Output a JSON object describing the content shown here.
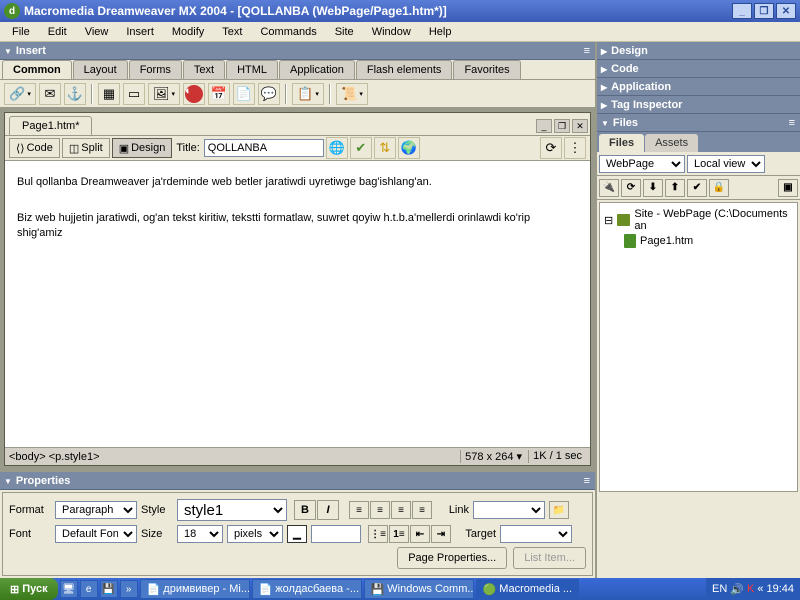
{
  "titlebar": {
    "title": "Macromedia Dreamweaver MX 2004 - [QOLLANBA (WebPage/Page1.htm*)]"
  },
  "menu": [
    "File",
    "Edit",
    "View",
    "Insert",
    "Modify",
    "Text",
    "Commands",
    "Site",
    "Window",
    "Help"
  ],
  "insert_panel": {
    "header": "Insert",
    "tabs": [
      "Common",
      "Layout",
      "Forms",
      "Text",
      "HTML",
      "Application",
      "Flash elements",
      "Favorites"
    ],
    "active_tab": "Common"
  },
  "document": {
    "tab": "Page1.htm*",
    "views": {
      "code": "Code",
      "split": "Split",
      "design": "Design"
    },
    "title_label": "Title:",
    "title_value": "QOLLANBA",
    "body_p1": "Bul qollanba Dreamweaver ja'rdeminde web betler jaratiwdi uyretiwge bag'ishlang'an.",
    "body_p2": "Biz web hujjetin jaratiwdi, og'an tekst kiritiw, tekstti formatlaw, suwret qoyiw h.t.b.a'mellerdi orinlawdi ko'rip shig'amiz",
    "status_left": "<body> <p.style1>",
    "status_dims": "578 x 264",
    "status_size": "1K / 1 sec"
  },
  "properties": {
    "header": "Properties",
    "format_label": "Format",
    "format_value": "Paragraph",
    "style_label": "Style",
    "style_value": "style1",
    "font_label": "Font",
    "font_value": "Default Font",
    "size_label": "Size",
    "size_value": "18",
    "units_value": "pixels",
    "link_label": "Link",
    "target_label": "Target",
    "page_props": "Page Properties...",
    "list_item": "List Item..."
  },
  "right_panels": {
    "design": "Design",
    "code": "Code",
    "application": "Application",
    "tag": "Tag Inspector",
    "files_hdr": "Files",
    "tabs": [
      "Files",
      "Assets"
    ],
    "site_select": "WebPage",
    "view_select": "Local view",
    "tree_root": "Site - WebPage (C:\\Documents an",
    "tree_item": "Page1.htm"
  },
  "taskbar": {
    "start": "Пуск",
    "tasks": [
      "дримвивер - Mi...",
      "жолдасбаева -...",
      "Windows Comm...",
      "Macromedia ..."
    ],
    "lang": "EN",
    "time": "19:44"
  }
}
